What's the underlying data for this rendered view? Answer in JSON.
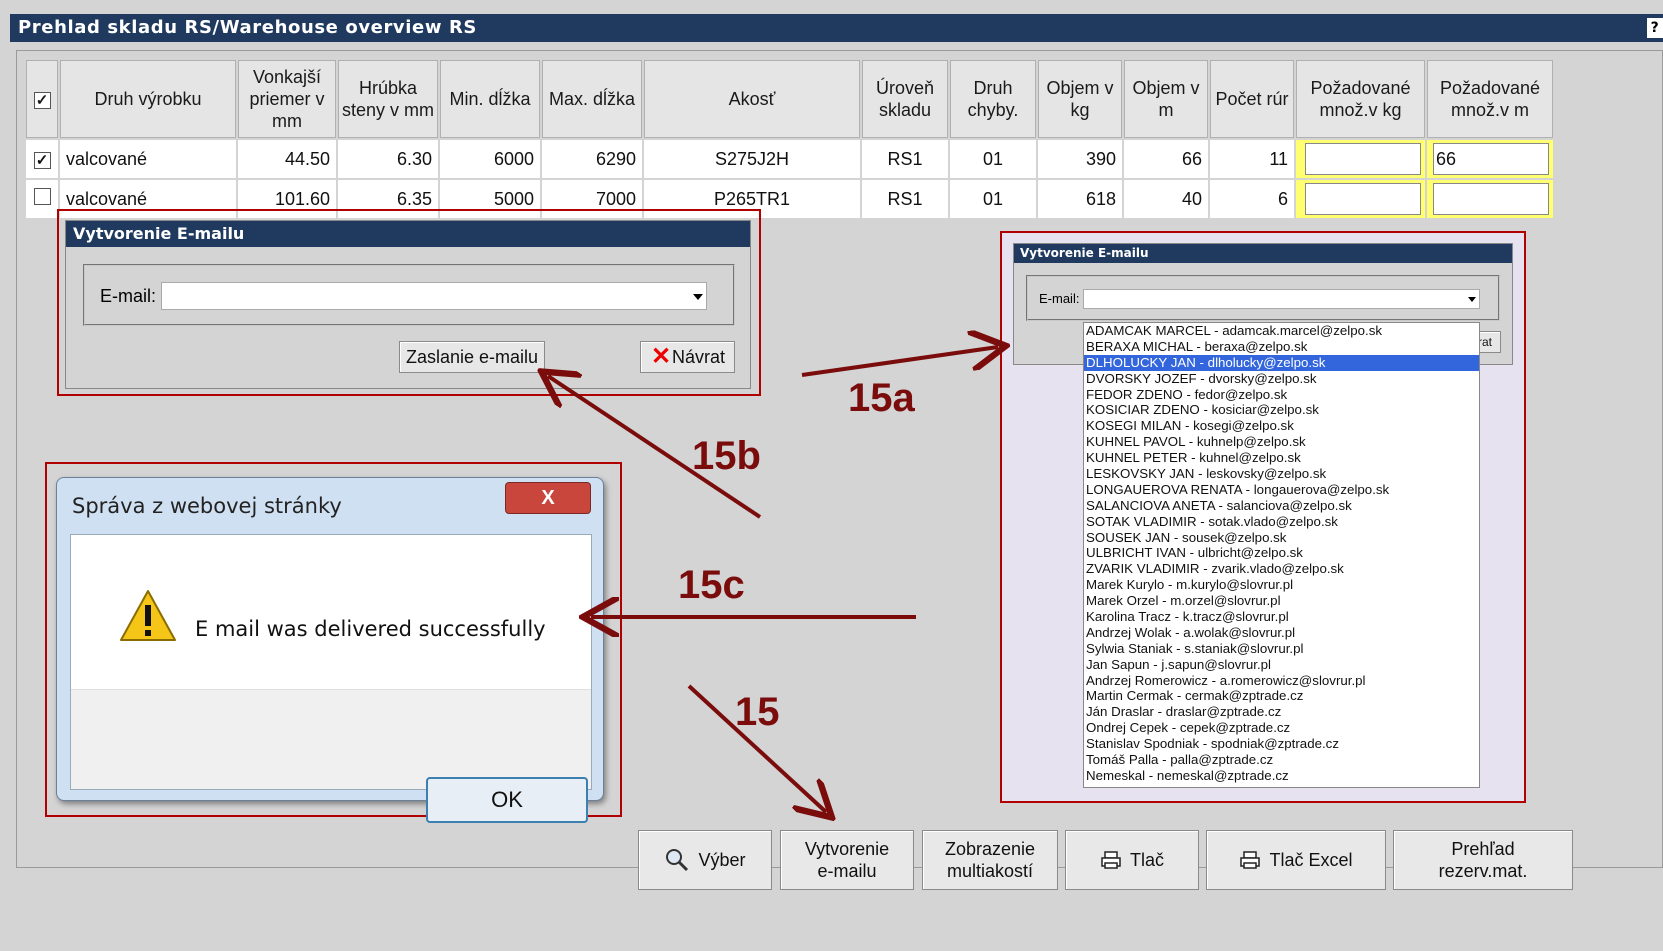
{
  "window": {
    "title": "Prehlad skladu RS/Warehouse overview RS",
    "help": "?"
  },
  "table": {
    "headers": [
      "Druh výrobku",
      "Vonkajší priemer v mm",
      "Hrúbka steny v mm",
      "Min. dĺžka",
      "Max. dĺžka",
      "Akosť",
      "Úroveň skladu",
      "Druh chyby.",
      "Objem v kg",
      "Objem v m",
      "Počet rúr",
      "Požadované množ.v kg",
      "Požadované množ.v m"
    ],
    "select_all_checked": true,
    "rows": [
      {
        "checked": true,
        "druh": "valcované",
        "priemer": "44.50",
        "hrubka": "6.30",
        "min": "6000",
        "max": "6290",
        "akost": "S275J2H",
        "uroven": "RS1",
        "chyba": "01",
        "kg": "390",
        "m": "66",
        "pocet": "11",
        "poz_kg": "",
        "poz_m": "66"
      },
      {
        "checked": false,
        "druh": "valcované",
        "priemer": "101.60",
        "hrubka": "6.35",
        "min": "5000",
        "max": "7000",
        "akost": "P265TR1",
        "uroven": "RS1",
        "chyba": "01",
        "kg": "618",
        "m": "40",
        "pocet": "6",
        "poz_kg": "",
        "poz_m": ""
      }
    ]
  },
  "email_dialog": {
    "title": "Vytvorenie E-mailu",
    "email_label": "E-mail:",
    "email_value": "",
    "send_button": "Zaslanie e-mailu",
    "back_button": "Návrat"
  },
  "email_dialog_open": {
    "title": "Vytvorenie E-mailu",
    "email_label": "E-mail:",
    "back_button_partial": "rat",
    "selected_index": 2,
    "options": [
      "ADAMCAK MARCEL - adamcak.marcel@zelpo.sk",
      "BERAXA MICHAL - beraxa@zelpo.sk",
      "DLHOLUCKY JAN - dlholucky@zelpo.sk",
      "DVORSKY JOZEF - dvorsky@zelpo.sk",
      "FEDOR ZDENO - fedor@zelpo.sk",
      "KOSICIAR ZDENO - kosiciar@zelpo.sk",
      "KOSEGI MILAN - kosegi@zelpo.sk",
      "KUHNEL PAVOL - kuhnelp@zelpo.sk",
      "KUHNEL PETER - kuhnel@zelpo.sk",
      "LESKOVSKY JAN - leskovsky@zelpo.sk",
      "LONGAUEROVA RENATA - longauerova@zelpo.sk",
      "SALANCIOVA ANETA - salanciova@zelpo.sk",
      "SOTAK VLADIMIR - sotak.vlado@zelpo.sk",
      "SOUSEK JAN - sousek@zelpo.sk",
      "ULBRICHT IVAN - ulbricht@zelpo.sk",
      "ZVARIK VLADIMIR - zvarik.vlado@zelpo.sk",
      "Marek Kurylo - m.kurylo@slovrur.pl",
      "Marek Orzel - m.orzel@slovrur.pl",
      "Karolina Tracz - k.tracz@slovrur.pl",
      "Andrzej Wolak - a.wolak@slovrur.pl",
      "Sylwia Staniak - s.staniak@slovrur.pl",
      "Jan Sapun - j.sapun@slovrur.pl",
      "Andrzej Romerowicz - a.romerowicz@slovrur.pl",
      "Martin Cermak - cermak@zptrade.cz",
      "Ján Draslar - draslar@zptrade.cz",
      "Ondrej Cepek - cepek@zptrade.cz",
      "Stanislav Spodniak - spodniak@zptrade.cz",
      "Tomáš Palla - palla@zptrade.cz",
      "Nemeskal - nemeskal@zptrade.cz"
    ]
  },
  "message_box": {
    "title": "Správa z webovej stránky",
    "message": "E mail was delivered successfully",
    "ok": "OK",
    "close": "X"
  },
  "annotations": {
    "a15a": "15a",
    "a15b": "15b",
    "a15c": "15c",
    "a15": "15",
    "color": "#7a0c0c"
  },
  "bottom_buttons": {
    "vyber": "Výber",
    "vytvorenie_1": "Vytvorenie",
    "vytvorenie_2": "e-mailu",
    "zobrazenie_1": "Zobrazenie",
    "zobrazenie_2": "multiakostí",
    "tlac": "Tlač",
    "tlac_excel": "Tlač Excel",
    "prehlad_1": "Prehľad",
    "prehlad_2": "rezerv.mat."
  }
}
